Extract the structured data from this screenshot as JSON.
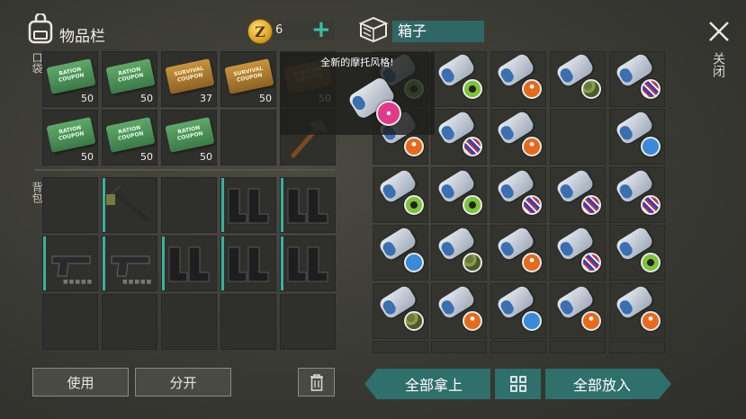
{
  "header": {
    "inventory_icon": "backpack-icon",
    "inventory_title": "物品栏",
    "coin_symbol": "Z",
    "coin_count": "6",
    "add_icon": "plus-icon",
    "container_icon": "box-icon",
    "container_title": "箱子",
    "close_icon": "close-icon",
    "close_label": "关闭"
  },
  "side_labels": {
    "pocket": "口袋",
    "backpack": "背包"
  },
  "pocket": [
    {
      "item": "coupon",
      "color": "green",
      "text": "RATION COUPON",
      "count": "50"
    },
    {
      "item": "coupon",
      "color": "green",
      "text": "RATION COUPON",
      "count": "50"
    },
    {
      "item": "coupon",
      "color": "orange",
      "text": "SURVIVAL COUPON",
      "count": "37"
    },
    {
      "item": "coupon",
      "color": "orange",
      "text": "SURVIVAL COUPON",
      "count": "50"
    },
    {
      "item": "coupon",
      "color": "orange",
      "text": "SURVIVAL COUPON",
      "count": "50"
    },
    {
      "item": "coupon",
      "color": "green",
      "text": "RATION COUPON",
      "count": "50"
    },
    {
      "item": "coupon",
      "color": "green",
      "text": "RATION COUPON",
      "count": "50"
    },
    {
      "item": "coupon",
      "color": "green",
      "text": "RATION COUPON",
      "count": "50"
    },
    {
      "item": "empty"
    },
    {
      "item": "hammer"
    }
  ],
  "backpack": [
    {
      "item": "empty"
    },
    {
      "item": "crossbow"
    },
    {
      "item": "empty"
    },
    {
      "item": "boots"
    },
    {
      "item": "boots"
    },
    {
      "item": "pistol"
    },
    {
      "item": "pistol"
    },
    {
      "item": "boots"
    },
    {
      "item": "boots"
    },
    {
      "item": "boots"
    },
    {
      "item": "empty"
    },
    {
      "item": "empty"
    },
    {
      "item": "empty"
    },
    {
      "item": "empty"
    },
    {
      "item": "empty"
    }
  ],
  "box_badges": [
    "bio",
    "bio",
    "moto",
    "camo",
    "flag",
    "moto",
    "flag",
    "moto",
    "empty",
    "blue",
    "bio",
    "bio",
    "flag",
    "flag",
    "flag",
    "blue",
    "camo",
    "moto",
    "flag",
    "bio",
    "camo",
    "moto",
    "blue",
    "moto",
    "moto"
  ],
  "tooltip": {
    "text": "全新的摩托风格!"
  },
  "buttons": {
    "use": "使用",
    "split": "分开",
    "trash_icon": "trash-icon",
    "take_all": "全部拿上",
    "sort_icon": "grid-icon",
    "put_all": "全部放入"
  },
  "colors": {
    "accent": "#37c2a8",
    "title_bg": "#2f6766",
    "tab_button": "#2f6f6c"
  }
}
